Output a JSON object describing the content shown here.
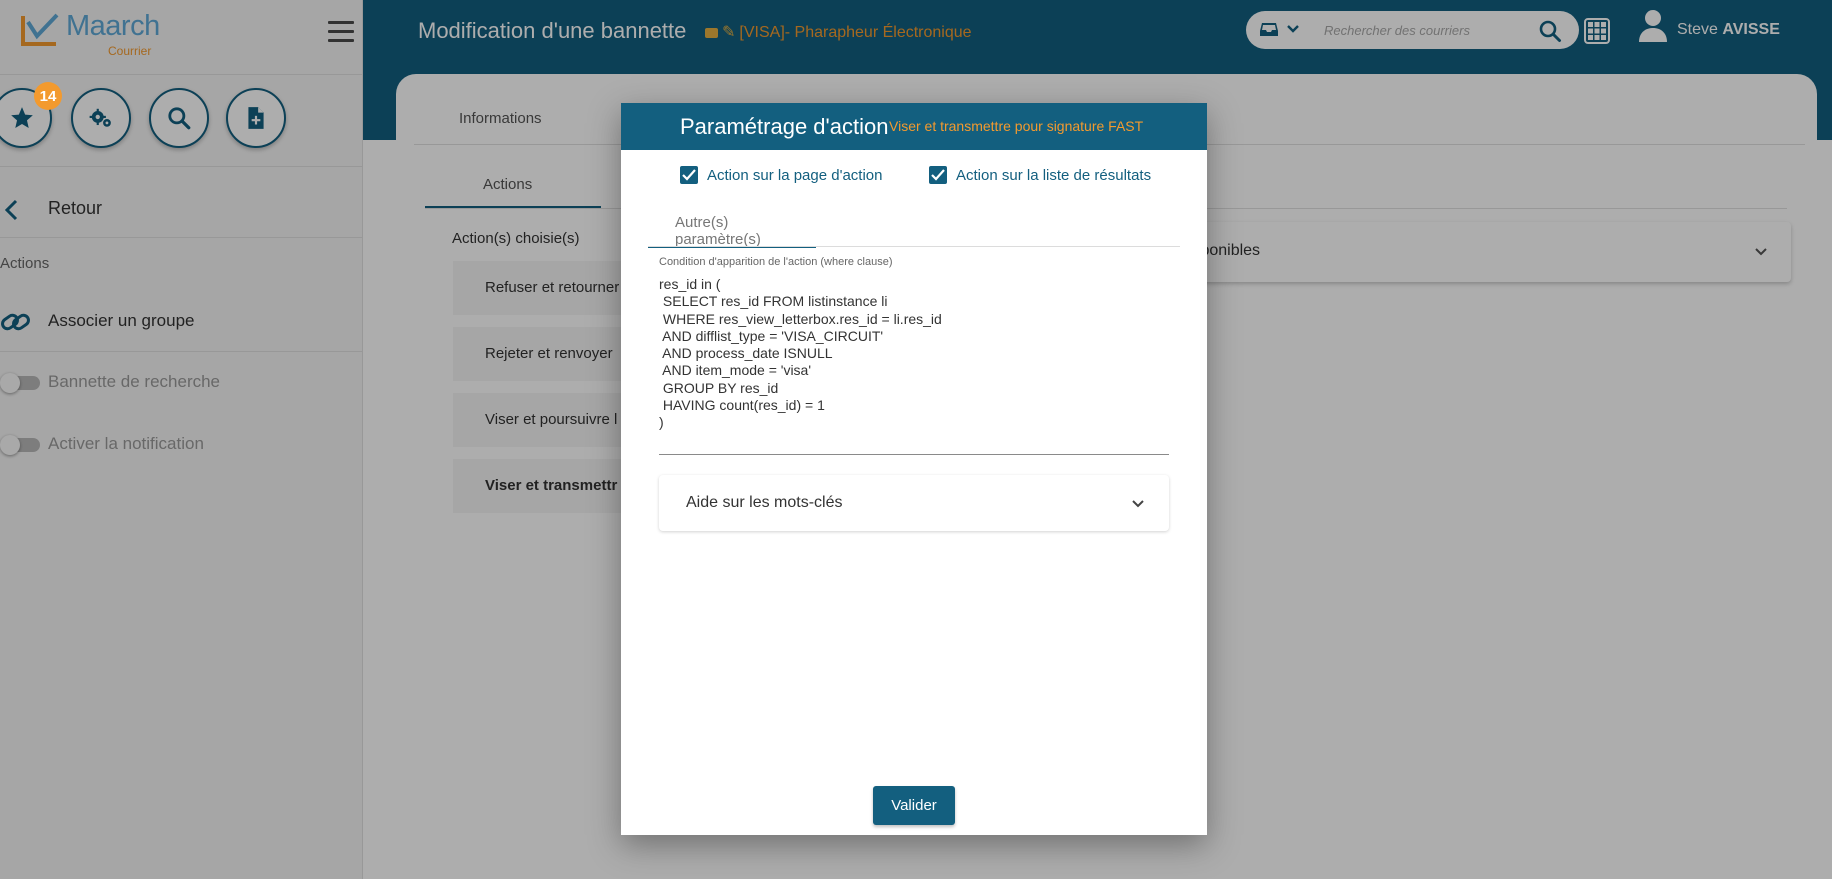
{
  "brand": {
    "name": "Maarch",
    "subtitle": "Courrier"
  },
  "sidebar": {
    "favorites_count": "14",
    "back_label": "Retour",
    "section_title": "Actions",
    "items": [
      {
        "label": "Associer un groupe"
      },
      {
        "label": "Bannette de recherche"
      },
      {
        "label": "Activer la notification"
      }
    ]
  },
  "header": {
    "title": "Modification d'une bannette",
    "subtitle": "[VISA]- Pharapheur Électronique",
    "search_placeholder": "Rechercher des courriers",
    "user_first": "Steve",
    "user_last": "AVISSE"
  },
  "content": {
    "tab_informations": "Informations",
    "tab_actions": "Actions",
    "chosen_label": "Action(s) choisie(s)",
    "chosen_actions": [
      {
        "label": "Refuser et retourner"
      },
      {
        "label": "Rejeter et renvoyer"
      },
      {
        "label": "Viser et poursuivre l"
      },
      {
        "label": "Viser et transmettr"
      }
    ],
    "available_label": "disponibles"
  },
  "dialog": {
    "title": "Paramétrage d'action",
    "subtitle": "Viser et transmettre pour signature FAST",
    "check_action_page": "Action sur la page d'action",
    "check_result_list": "Action sur la liste de résultats",
    "tab_other_params": "Autre(s) paramètre(s)",
    "condition_label": "Condition d'apparition de l'action (where clause)",
    "condition_value": "res_id in (\n SELECT res_id FROM listinstance li\n WHERE res_view_letterbox.res_id = li.res_id\n AND difflist_type = 'VISA_CIRCUIT'\n AND process_date ISNULL\n AND item_mode = 'visa'\n GROUP BY res_id\n HAVING count(res_id) = 1\n)",
    "help_label": "Aide sur les mots-clés",
    "submit_label": "Valider"
  },
  "colors": {
    "primary": "#135f7f",
    "accent": "#f39a2e"
  }
}
